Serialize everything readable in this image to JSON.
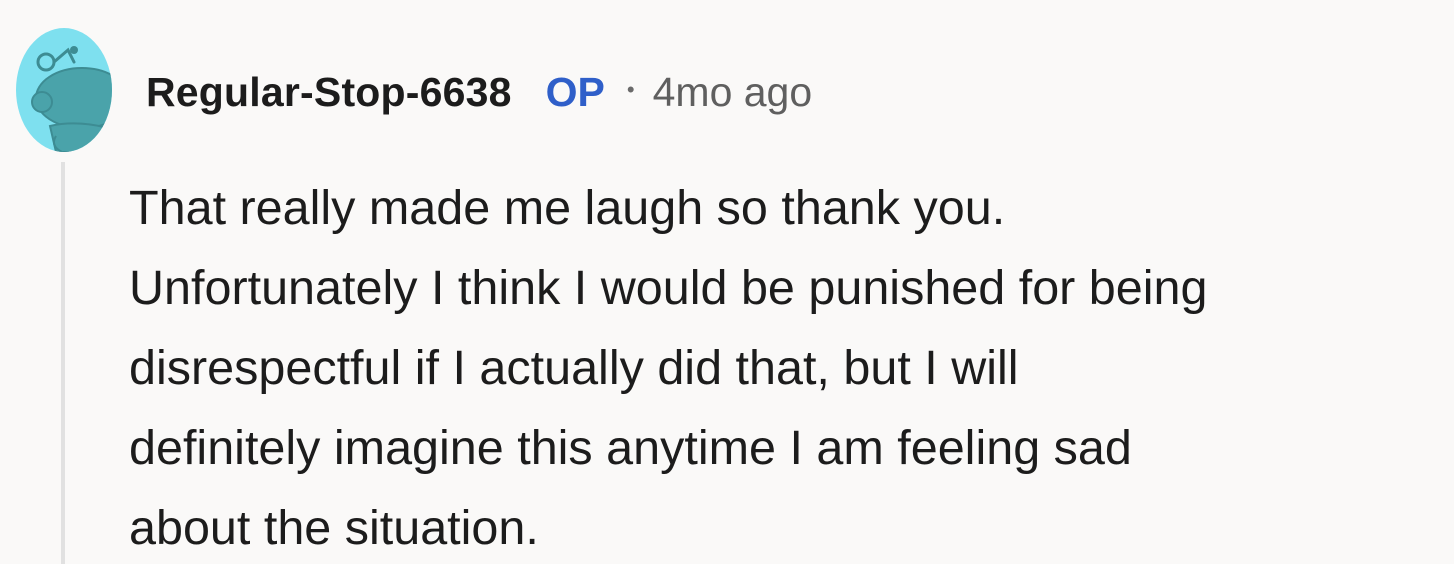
{
  "comment": {
    "author": "Regular-Stop-6638",
    "badge": "OP",
    "separator": "•",
    "timestamp": "4mo ago",
    "avatar_icon": "snoo-avatar-icon",
    "body_lines": [
      "That really made me laugh so thank you.",
      "Unfortunately I think I would be punished for being",
      "disrespectful if I actually did that, but I will",
      "definitely imagine this anytime I am feeling sad",
      "about the situation."
    ]
  },
  "colors": {
    "background": "#faf9f8",
    "avatar_bg": "#7ee0ef",
    "avatar_figure": "#4aa3aa",
    "op_badge": "#2f5fc9",
    "timestamp": "#5f5f5f",
    "thread_line": "#e1e1e1"
  }
}
